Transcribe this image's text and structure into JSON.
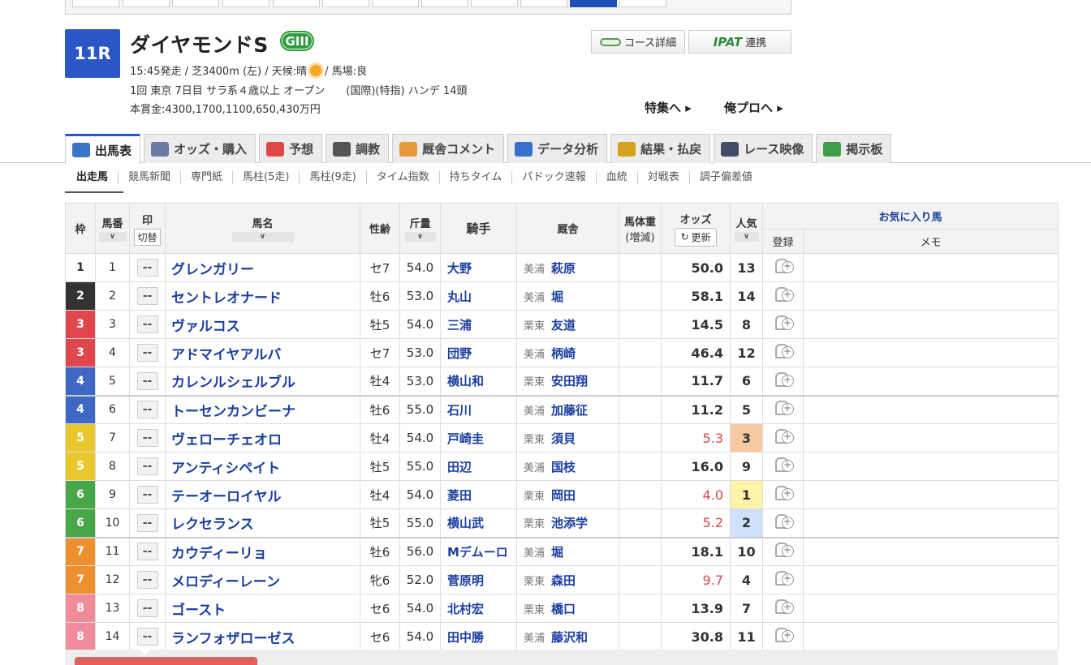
{
  "race": {
    "number": "11R",
    "name": "ダイヤモンドS",
    "grade": "GIII",
    "line1_a": "15:45発走 / 芝3400m (左) / 天候:晴",
    "line1_b": "/ 馬場:良",
    "line2": "1回 東京 7日目 サラ系４歳以上 オープン　　(国際)(特指) ハンデ 14頭",
    "line3": "本賞金:4300,1700,1100,650,430万円",
    "weather_icon": "sun-icon"
  },
  "buttons": {
    "course": "コース詳細",
    "ipat_logo": "IPAT",
    "ipat": "連携"
  },
  "links": {
    "feature": "特集へ ▸",
    "orepro": "俺プロへ ▸"
  },
  "tabs": [
    {
      "label": "出馬表",
      "color": "#3b73c7"
    },
    {
      "label": "オッズ・購入",
      "color": "#6a7aa0"
    },
    {
      "label": "予想",
      "color": "#e04848"
    },
    {
      "label": "調教",
      "color": "#555555"
    },
    {
      "label": "厩舎コメント",
      "color": "#e89a3a"
    },
    {
      "label": "データ分析",
      "color": "#3a6fd0"
    },
    {
      "label": "結果・払戻",
      "color": "#d6a21e"
    },
    {
      "label": "レース映像",
      "color": "#444c66"
    },
    {
      "label": "掲示板",
      "color": "#3e9c4a"
    }
  ],
  "subtabs": [
    "出走馬",
    "競馬新聞",
    "専門紙",
    "馬柱(5走)",
    "馬柱(9走)",
    "タイム指数",
    "持ちタイム",
    "パドック速報",
    "血統",
    "対戦表",
    "調子偏差値"
  ],
  "columns": {
    "waku": "枠",
    "umaban": "馬番",
    "mark": "印",
    "kiri": "切替",
    "horse": "馬名",
    "sexage": "性齢",
    "kinryo": "斤量",
    "jockey": "騎手",
    "trainer": "厩舎",
    "weight": "馬体重",
    "weight_sub": "(増減)",
    "odds": "オッズ",
    "refresh": "更新",
    "pop": "人気",
    "fav": "お気に入り馬",
    "reg": "登録",
    "memo": "メモ",
    "sort": "∨"
  },
  "mark_default": "--",
  "waku_colors": {
    "1": "#ffffff",
    "2": "#333333",
    "3": "#e0474c",
    "4": "#3e68c3",
    "5": "#e8c82d",
    "6": "#47a647",
    "7": "#ee9030",
    "8": "#f08c9a"
  },
  "rows": [
    {
      "waku": "1",
      "umaban": "1",
      "horse": "グレンガリー",
      "sexage": "セ7",
      "kinryo": "54.0",
      "jockey": "大野",
      "area": "美浦",
      "trainer": "萩原",
      "odds": "50.0",
      "pop": "13"
    },
    {
      "waku": "2",
      "umaban": "2",
      "horse": "セントレオナード",
      "sexage": "牡6",
      "kinryo": "53.0",
      "jockey": "丸山",
      "area": "美浦",
      "trainer": "堀",
      "odds": "58.1",
      "pop": "14"
    },
    {
      "waku": "3",
      "umaban": "3",
      "horse": "ヴァルコス",
      "sexage": "牡5",
      "kinryo": "54.0",
      "jockey": "三浦",
      "area": "栗東",
      "trainer": "友道",
      "odds": "14.5",
      "pop": "8"
    },
    {
      "waku": "3",
      "umaban": "4",
      "horse": "アドマイヤアルバ",
      "sexage": "セ7",
      "kinryo": "53.0",
      "jockey": "団野",
      "area": "美浦",
      "trainer": "柄崎",
      "odds": "46.4",
      "pop": "12"
    },
    {
      "waku": "4",
      "umaban": "5",
      "horse": "カレンルシェルブル",
      "sexage": "牡4",
      "kinryo": "53.0",
      "jockey": "横山和",
      "area": "栗東",
      "trainer": "安田翔",
      "odds": "11.7",
      "pop": "6"
    },
    {
      "waku": "4",
      "umaban": "6",
      "horse": "トーセンカンビーナ",
      "sexage": "牡6",
      "kinryo": "55.0",
      "jockey": "石川",
      "area": "美浦",
      "trainer": "加藤征",
      "odds": "11.2",
      "pop": "5"
    },
    {
      "waku": "5",
      "umaban": "7",
      "horse": "ヴェローチェオロ",
      "sexage": "牡4",
      "kinryo": "54.0",
      "jockey": "戸崎圭",
      "area": "栗東",
      "trainer": "須貝",
      "odds": "5.3",
      "pop": "3"
    },
    {
      "waku": "5",
      "umaban": "8",
      "horse": "アンティシペイト",
      "sexage": "牡5",
      "kinryo": "55.0",
      "jockey": "田辺",
      "area": "美浦",
      "trainer": "国枝",
      "odds": "16.0",
      "pop": "9"
    },
    {
      "waku": "6",
      "umaban": "9",
      "horse": "テーオーロイヤル",
      "sexage": "牡4",
      "kinryo": "54.0",
      "jockey": "菱田",
      "area": "栗東",
      "trainer": "岡田",
      "odds": "4.0",
      "pop": "1"
    },
    {
      "waku": "6",
      "umaban": "10",
      "horse": "レクセランス",
      "sexage": "牡5",
      "kinryo": "55.0",
      "jockey": "横山武",
      "area": "栗東",
      "trainer": "池添学",
      "odds": "5.2",
      "pop": "2"
    },
    {
      "waku": "7",
      "umaban": "11",
      "horse": "カウディーリョ",
      "sexage": "牡6",
      "kinryo": "56.0",
      "jockey": "Mデムーロ",
      "area": "美浦",
      "trainer": "堀",
      "odds": "18.1",
      "pop": "10"
    },
    {
      "waku": "7",
      "umaban": "12",
      "horse": "メロディーレーン",
      "sexage": "牝6",
      "kinryo": "52.0",
      "jockey": "菅原明",
      "area": "栗東",
      "trainer": "森田",
      "odds": "9.7",
      "pop": "4"
    },
    {
      "waku": "8",
      "umaban": "13",
      "horse": "ゴースト",
      "sexage": "セ6",
      "kinryo": "54.0",
      "jockey": "北村宏",
      "area": "栗東",
      "trainer": "橋口",
      "odds": "13.9",
      "pop": "7"
    },
    {
      "waku": "8",
      "umaban": "14",
      "horse": "ランフォザローゼス",
      "sexage": "セ6",
      "kinryo": "54.0",
      "jockey": "田中勝",
      "area": "美浦",
      "trainer": "藤沢和",
      "odds": "30.8",
      "pop": "11"
    }
  ]
}
